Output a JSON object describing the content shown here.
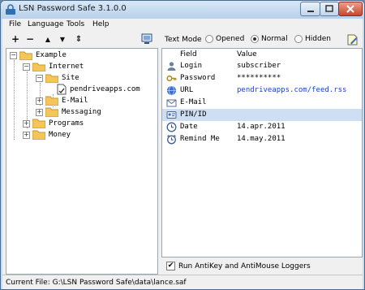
{
  "window": {
    "title": "LSN Password Safe 3.1.0.0"
  },
  "menu": [
    "File",
    "Language",
    "Tools",
    "Help"
  ],
  "toolbar": {
    "add": "+",
    "remove": "−",
    "up": "▲",
    "down": "▼",
    "move": "⇕"
  },
  "tree": {
    "root": "Example",
    "internet": "Internet",
    "site": "Site",
    "entry": "pendriveapps.com",
    "email": "E-Mail",
    "messaging": "Messaging",
    "programs": "Programs",
    "money": "Money"
  },
  "text_mode": {
    "label": "Text Mode",
    "options": [
      "Opened",
      "Normal",
      "Hidden"
    ],
    "selected": "Normal"
  },
  "fields": {
    "header_field": "Field",
    "header_value": "Value",
    "rows": [
      {
        "name": "Login",
        "value": "subscriber",
        "icon": "user-icon"
      },
      {
        "name": "Password",
        "value": "**********",
        "icon": "key-icon"
      },
      {
        "name": "URL",
        "value": "pendriveapps.com/feed.rss",
        "icon": "globe-icon"
      },
      {
        "name": "E-Mail",
        "value": "",
        "icon": "mail-icon"
      },
      {
        "name": "PIN/ID",
        "value": "",
        "icon": "id-card-icon"
      },
      {
        "name": "Date",
        "value": "14.apr.2011",
        "icon": "clock-icon"
      },
      {
        "name": "Remind Me",
        "value": "14.may.2011",
        "icon": "alarm-icon"
      }
    ]
  },
  "anti_key": {
    "label": "Run AntiKey and AntiMouse Loggers",
    "checked": true,
    "mark": "✔"
  },
  "status": {
    "text": "Current File: G:\\LSN Password Safe\\data\\lance.saf"
  },
  "colors": {
    "accent": "#cfdff3",
    "link": "#1a43c7",
    "folder": "#f3c65b"
  }
}
